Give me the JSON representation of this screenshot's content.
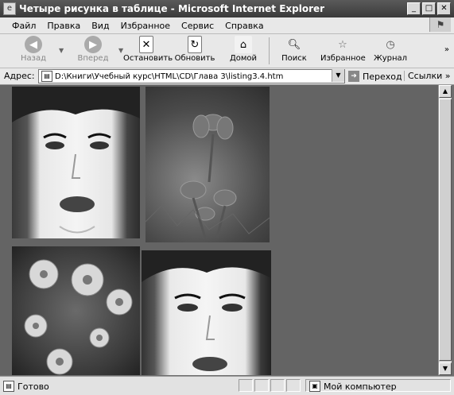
{
  "window": {
    "title": "Четыре рисунка в таблице - Microsoft Internet Explorer"
  },
  "menu": {
    "items": [
      "Файл",
      "Правка",
      "Вид",
      "Избранное",
      "Сервис",
      "Справка"
    ]
  },
  "toolbar": {
    "back": "Назад",
    "forward": "Вперед",
    "stop": "Остановить",
    "refresh": "Обновить",
    "home": "Домой",
    "search": "Поиск",
    "favorites": "Избранное",
    "history": "Журнал"
  },
  "address": {
    "label": "Адрес:",
    "url": "D:\\Книги\\Учебный курс\\HTML\\CD\\Глава 3\\listing3.4.htm",
    "go": "Переход",
    "links": "Ссылки"
  },
  "status": {
    "text": "Готово",
    "zone": "Мой компьютер"
  },
  "icons": {
    "back": "back-arrow-icon",
    "forward": "forward-arrow-icon",
    "stop": "stop-page-icon",
    "refresh": "refresh-page-icon",
    "home": "home-icon",
    "search": "search-magnifier-icon",
    "favorites": "favorites-star-icon",
    "history": "history-clock-icon"
  }
}
